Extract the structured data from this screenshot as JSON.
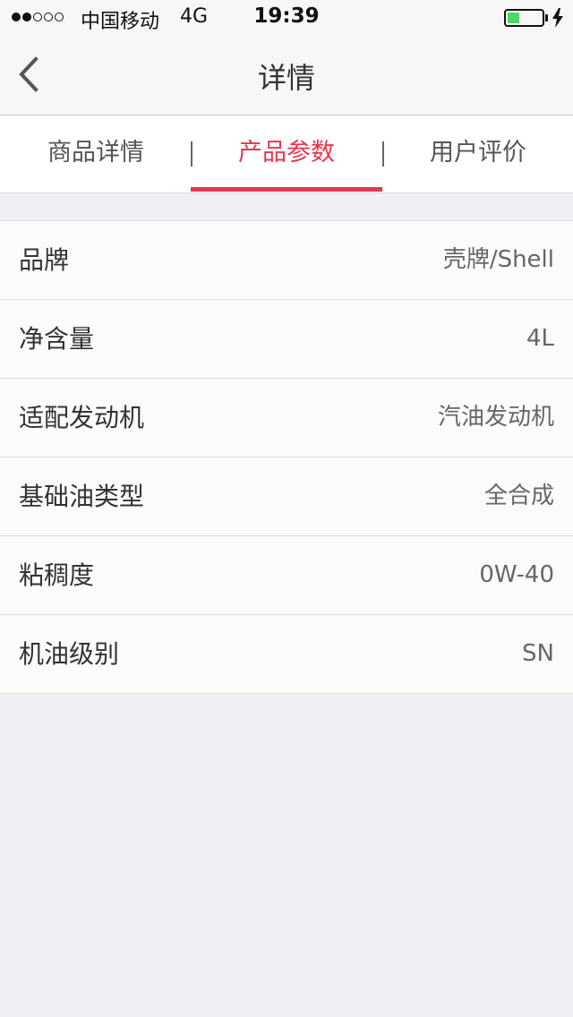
{
  "status_bar": {
    "carrier": "中国移动",
    "network": "4G",
    "time": "19:39",
    "signal_strength": 2,
    "signal_max": 5,
    "battery_level": 0.35,
    "battery_color": "#4cd964"
  },
  "nav": {
    "title": "详情",
    "back_icon": "chevron-left-icon"
  },
  "tabs": [
    {
      "label": "商品详情",
      "active": false
    },
    {
      "label": "产品参数",
      "active": true
    },
    {
      "label": "用户评价",
      "active": false
    }
  ],
  "accent_color": "#e8364f",
  "params": [
    {
      "label": "品牌",
      "value": "壳牌/Shell"
    },
    {
      "label": "净含量",
      "value": "4L"
    },
    {
      "label": "适配发动机",
      "value": "汽油发动机"
    },
    {
      "label": "基础油类型",
      "value": "全合成"
    },
    {
      "label": "粘稠度",
      "value": "0W-40"
    },
    {
      "label": "机油级别",
      "value": "SN"
    }
  ]
}
